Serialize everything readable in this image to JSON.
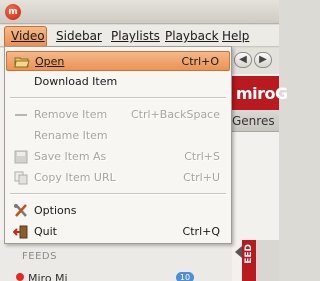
{
  "window": {
    "app_icon_letter": "m"
  },
  "menubar": {
    "items": [
      {
        "label": "Video"
      },
      {
        "label": "Sidebar"
      },
      {
        "label": "Playlists"
      },
      {
        "label": "Playback"
      },
      {
        "label": "Help"
      }
    ]
  },
  "menu": {
    "items": [
      {
        "label": "Open",
        "accel": "Ctrl+O",
        "icon": "folder-open-icon",
        "enabled": true,
        "highlighted": true
      },
      {
        "label": "Download Item",
        "accel": "",
        "icon": "",
        "enabled": true
      },
      {
        "label": "Remove Item",
        "accel": "Ctrl+BackSpace",
        "icon": "remove-icon",
        "enabled": false
      },
      {
        "label": "Rename Item",
        "accel": "",
        "icon": "",
        "enabled": false
      },
      {
        "label": "Save Item As",
        "accel": "Ctrl+S",
        "icon": "save-icon",
        "enabled": false
      },
      {
        "label": "Copy Item URL",
        "accel": "Ctrl+U",
        "icon": "copy-icon",
        "enabled": false
      },
      {
        "label": "Options",
        "accel": "",
        "icon": "tools-icon",
        "enabled": true
      },
      {
        "label": "Quit",
        "accel": "Ctrl+Q",
        "icon": "quit-icon",
        "enabled": true
      }
    ]
  },
  "background": {
    "banner_text": "miroG",
    "tab_text": "Genres",
    "sidebar_section": "FEEDS",
    "feed_item": "Miro Mi",
    "feed_badge": "10",
    "strip_text": "EED"
  },
  "colors": {
    "highlight": "#eb9355",
    "banner": "#b9191f",
    "menu_bg": "#f7f6f3"
  }
}
